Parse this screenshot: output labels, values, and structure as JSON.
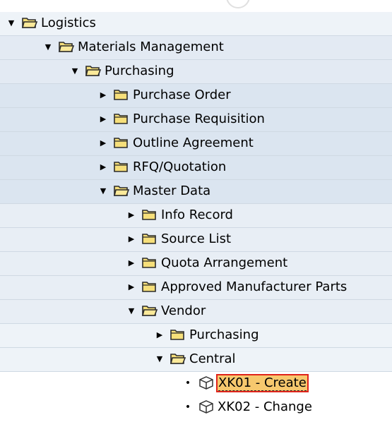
{
  "tree": {
    "nodes": [
      {
        "label": "Logistics",
        "level": 0,
        "state": "expanded",
        "icon": "folder-open-icon"
      },
      {
        "label": "Materials Management",
        "level": 1,
        "state": "expanded",
        "icon": "folder-open-icon"
      },
      {
        "label": "Purchasing",
        "level": 2,
        "state": "expanded",
        "icon": "folder-open-icon"
      },
      {
        "label": "Purchase Order",
        "level": 3,
        "state": "collapsed",
        "icon": "folder-closed-icon"
      },
      {
        "label": "Purchase Requisition",
        "level": 3,
        "state": "collapsed",
        "icon": "folder-closed-icon"
      },
      {
        "label": "Outline Agreement",
        "level": 3,
        "state": "collapsed",
        "icon": "folder-closed-icon"
      },
      {
        "label": "RFQ/Quotation",
        "level": 3,
        "state": "collapsed",
        "icon": "folder-closed-icon"
      },
      {
        "label": "Master Data",
        "level": 3,
        "state": "expanded",
        "icon": "folder-open-icon"
      },
      {
        "label": "Info Record",
        "level": 4,
        "state": "collapsed",
        "icon": "folder-closed-icon"
      },
      {
        "label": "Source List",
        "level": 4,
        "state": "collapsed",
        "icon": "folder-closed-icon"
      },
      {
        "label": "Quota Arrangement",
        "level": 4,
        "state": "collapsed",
        "icon": "folder-closed-icon"
      },
      {
        "label": "Approved Manufacturer Parts",
        "level": 4,
        "state": "collapsed",
        "icon": "folder-closed-icon"
      },
      {
        "label": "Vendor",
        "level": 4,
        "state": "expanded",
        "icon": "folder-open-icon"
      },
      {
        "label": "Purchasing",
        "level": 5,
        "state": "collapsed",
        "icon": "folder-closed-icon"
      },
      {
        "label": "Central",
        "level": 5,
        "state": "expanded",
        "icon": "folder-open-icon"
      },
      {
        "label": "XK01 - Create",
        "level": 6,
        "state": "leaf",
        "icon": "transaction-cube-icon",
        "selected": true
      },
      {
        "label": "XK02 - Change",
        "level": 6,
        "state": "leaf",
        "icon": "transaction-cube-icon",
        "selected": false
      }
    ]
  },
  "colors": {
    "selection_fill": "#f7c86e",
    "selection_border": "#e0241b",
    "folder_fill": "#f6df7a",
    "folder_stroke": "#2b2b2b"
  }
}
